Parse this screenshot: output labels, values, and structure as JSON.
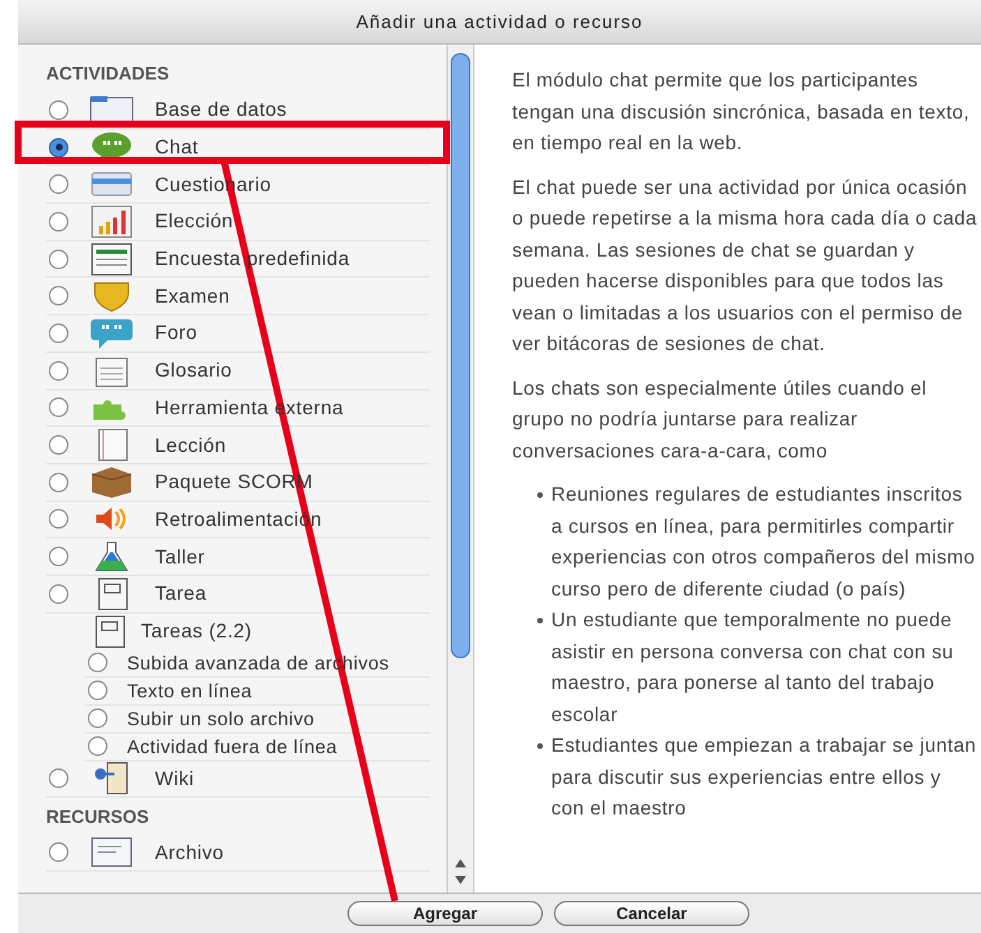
{
  "window": {
    "title": "Añadir una actividad o recurso"
  },
  "sections": [
    {
      "heading": "ACTIVIDADES",
      "items": [
        {
          "kind": "option",
          "label": "Base de datos",
          "selected": false
        },
        {
          "kind": "option",
          "label": "Chat",
          "selected": true
        },
        {
          "kind": "option",
          "label": "Cuestionario",
          "selected": false
        },
        {
          "kind": "option",
          "label": "Elección",
          "selected": false
        },
        {
          "kind": "option",
          "label": "Encuesta predefinida",
          "selected": false
        },
        {
          "kind": "option",
          "label": "Examen",
          "selected": false
        },
        {
          "kind": "option",
          "label": "Foro",
          "selected": false
        },
        {
          "kind": "option",
          "label": "Glosario",
          "selected": false
        },
        {
          "kind": "option",
          "label": "Herramienta externa",
          "selected": false
        },
        {
          "kind": "option",
          "label": "Lección",
          "selected": false
        },
        {
          "kind": "option",
          "label": "Paquete SCORM",
          "selected": false
        },
        {
          "kind": "option",
          "label": "Retroalimentación",
          "selected": false
        },
        {
          "kind": "option",
          "label": "Taller",
          "selected": false
        },
        {
          "kind": "option",
          "label": "Tarea",
          "selected": false
        },
        {
          "kind": "group",
          "label": "Tareas (2.2)",
          "children": [
            {
              "label": "Subida avanzada de archivos",
              "selected": false
            },
            {
              "label": "Texto en línea",
              "selected": false
            },
            {
              "label": "Subir un solo archivo",
              "selected": false
            },
            {
              "label": "Actividad fuera de línea",
              "selected": false
            }
          ]
        },
        {
          "kind": "option",
          "label": "Wiki",
          "selected": false
        }
      ]
    },
    {
      "heading": "RECURSOS",
      "items": [
        {
          "kind": "option",
          "label": "Archivo",
          "selected": false
        }
      ]
    }
  ],
  "description": {
    "paragraphs": [
      "El módulo chat permite que los participantes tengan una discusión sincrónica, basada en texto, en tiempo real en la web.",
      "El chat puede ser una actividad por única ocasión o puede repetirse a la misma hora cada día o cada semana. Las sesiones de chat se guardan y pueden hacerse disponibles para que todos las vean o limitadas a los usuarios con el permiso de ver bitácoras de sesiones de chat.",
      "Los chats son especialmente útiles cuando el grupo no podría juntarse para realizar conversaciones cara-a-cara, como"
    ],
    "bullets": [
      "Reuniones regulares de estudiantes inscritos a cursos en línea, para permitirles compartir experiencias con otros compañeros del mismo curso pero de diferente ciudad (o país)",
      "Un estudiante que temporalmente no puede asistir en persona conversa con chat con su maestro, para ponerse al tanto del trabajo escolar",
      "Estudiantes que empiezan a trabajar se juntan para discutir sus experiencias entre ellos y con el maestro"
    ]
  },
  "buttons": [
    {
      "label": "Agregar"
    },
    {
      "label": "Cancelar"
    }
  ]
}
